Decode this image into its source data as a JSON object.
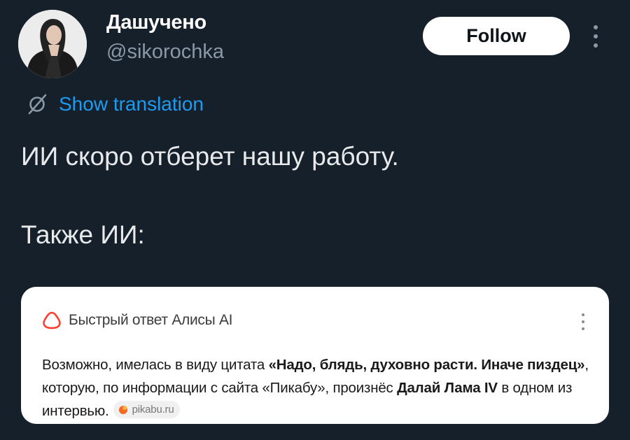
{
  "author": {
    "display_name": "Дашучено",
    "handle": "@sikorochka"
  },
  "follow_label": "Follow",
  "translate_label": "Show translation",
  "tweet": {
    "line1": "ИИ скоро отберет нашу работу.",
    "line2": "Также ИИ:"
  },
  "card": {
    "title": "Быстрый ответ Алисы AI",
    "body": {
      "t1": "Возможно, имелась в виду цитата ",
      "b1": "«Надо, блядь, духовно расти. Иначе пиздец»",
      "t2": ", которую, по информации с сайта «Пикабу», произнёс ",
      "b2": "Далай Лама IV",
      "t3": " в одном из интервью."
    },
    "source": {
      "label": "pikabu.ru",
      "icon": "pikabu-icon"
    }
  },
  "colors": {
    "background": "#15202b",
    "link": "#1d9bf0",
    "alice_accent": "#ff3d2e",
    "pikabu_accent": "#f46a23"
  }
}
